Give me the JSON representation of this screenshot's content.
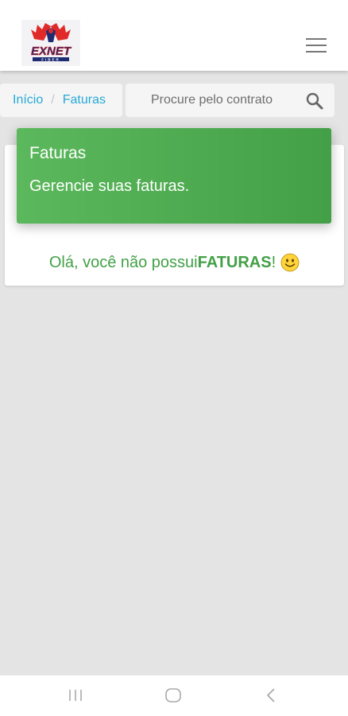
{
  "header": {
    "logo": {
      "text_main": "EXNET",
      "text_sub": "FIBER",
      "colors": {
        "red": "#e02a2a",
        "navy": "#1d2b73"
      }
    },
    "menu_icon": "hamburger-menu-icon"
  },
  "breadcrumb": {
    "home_label": "Início",
    "separator": "/",
    "current_label": "Faturas"
  },
  "search": {
    "placeholder": "Procure pelo contrato",
    "value": "",
    "icon": "search-icon"
  },
  "card": {
    "title": "Faturas",
    "subtitle": "Gerencie suas faturas.",
    "empty_message": {
      "prefix": "Olá, você não possui ",
      "emphasis": "FATURAS",
      "suffix": "!",
      "icon": "smiley-icon"
    },
    "colors": {
      "header_start": "#5cb85c",
      "header_end": "#43a047",
      "message": "#43a047"
    }
  },
  "system_nav": {
    "buttons": [
      "recents-icon",
      "home-icon",
      "back-icon"
    ]
  },
  "colors": {
    "background": "#e4e4e4",
    "link": "#26a9d6"
  }
}
